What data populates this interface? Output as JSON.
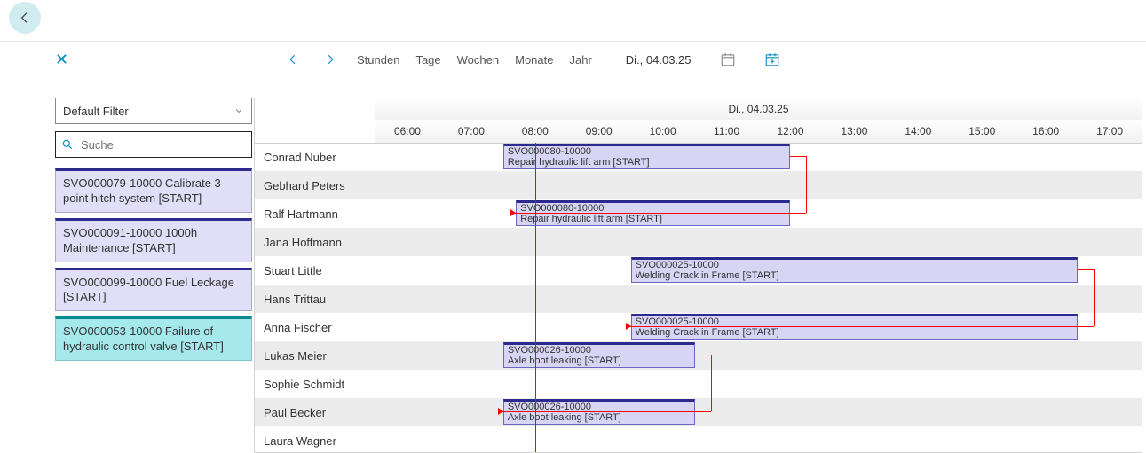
{
  "header": {
    "date_display": "Di., 04.03.25"
  },
  "scales": {
    "hours": "Stunden",
    "days": "Tage",
    "weeks": "Wochen",
    "months": "Monate",
    "year": "Jahr"
  },
  "sidebar": {
    "filter_label": "Default Filter",
    "search_placeholder": "Suche",
    "orders": [
      {
        "text": "SVO000079-10000 Calibrate 3-point hitch system [START]",
        "cls": "order-purple"
      },
      {
        "text": "SVO000091-10000 1000h Maintenance [START]",
        "cls": "order-purple"
      },
      {
        "text": "SVO000099-10000 Fuel Leckage [START]",
        "cls": "order-purple"
      },
      {
        "text": "SVO000053-10000 Failure of hydraulic control valve [START]",
        "cls": "order-teal"
      }
    ]
  },
  "planner": {
    "date_header": "Di., 04.03.25",
    "hours": [
      "06:00",
      "07:00",
      "08:00",
      "09:00",
      "10:00",
      "11:00",
      "12:00",
      "13:00",
      "14:00",
      "15:00",
      "16:00",
      "17:00"
    ],
    "time_start": 6,
    "time_end": 18,
    "now": 8.5,
    "resources": [
      "Conrad Nuber",
      "Gebhard Peters",
      "Ralf Hartmann",
      "Jana Hoffmann",
      "Stuart Little",
      "Hans Trittau",
      "Anna Fischer",
      "Lukas Meier",
      "Sophie Schmidt",
      "Paul Becker",
      "Laura Wagner"
    ],
    "tasks": [
      {
        "id": "t1",
        "row": 0,
        "start": 8.0,
        "end": 12.5,
        "l1": "SVO000080-10000",
        "l2": "Repair hydraulic lift arm [START]"
      },
      {
        "id": "t2",
        "row": 2,
        "start": 8.2,
        "end": 12.5,
        "l1": "SVO000080-10000",
        "l2": "Repair hydraulic lift arm [START]"
      },
      {
        "id": "t3",
        "row": 4,
        "start": 10.0,
        "end": 17.0,
        "l1": "SVO000025-10000",
        "l2": "Welding Crack in Frame [START]"
      },
      {
        "id": "t4",
        "row": 6,
        "start": 10.0,
        "end": 17.0,
        "l1": "SVO000025-10000",
        "l2": "Welding Crack in Frame [START]"
      },
      {
        "id": "t5",
        "row": 7,
        "start": 8.0,
        "end": 11.0,
        "l1": "SVO000026-10000",
        "l2": "Axle boot leaking [START]"
      },
      {
        "id": "t6",
        "row": 9,
        "start": 8.0,
        "end": 11.0,
        "l1": "SVO000026-10000",
        "l2": "Axle boot leaking [START]"
      }
    ],
    "deps": [
      {
        "from": "t1",
        "to": "t2",
        "side": "end-start"
      },
      {
        "from": "t3",
        "to": "t4",
        "side": "end-start"
      },
      {
        "from": "t5",
        "to": "t6",
        "side": "end-start"
      }
    ]
  }
}
